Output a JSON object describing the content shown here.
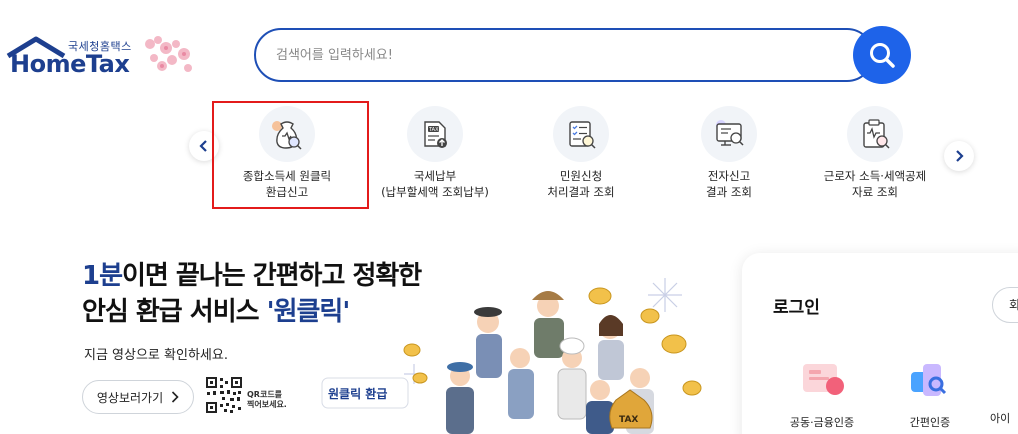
{
  "header": {
    "logo_sub": "국세청홈택스",
    "logo_main": "HomeTax",
    "search_placeholder": "검색어를 입력하세요!"
  },
  "quick_menu": [
    {
      "line1": "종합소득세 원클릭",
      "line2": "환급신고",
      "icon": "money-bag-search-icon"
    },
    {
      "line1": "국세납부",
      "line2": "(납부할세액 조회납부)",
      "icon": "tax-document-icon"
    },
    {
      "line1": "민원신청",
      "line2": "처리결과 조회",
      "icon": "checklist-search-icon"
    },
    {
      "line1": "전자신고",
      "line2": "결과 조회",
      "icon": "monitor-search-icon"
    },
    {
      "line1": "근로자 소득·세액공제",
      "line2": "자료 조회",
      "icon": "clipboard-search-icon"
    }
  ],
  "banner": {
    "title_accent": "1분",
    "title_line1_rest": "이면 끝나는 간편하고 정확한",
    "title_line2_plain": "안심 환급 서비스 ",
    "title_line2_accent": "'원클릭'",
    "subtitle": "지금 영상으로 확인하세요.",
    "video_button": "영상보러가기",
    "qr_line1": "QR코드를",
    "qr_line2": "찍어보세요.",
    "sign_text": "원클릭 환급",
    "bag_text": "TAX"
  },
  "login": {
    "title": "로그인",
    "button": "회원가입",
    "methods": [
      {
        "label": "공동·금융인증",
        "icon": "certificate-icon"
      },
      {
        "label": "간편인증",
        "icon": "simple-auth-icon"
      },
      {
        "label": "아이",
        "icon": "id-icon"
      }
    ]
  },
  "colors": {
    "brand": "#1d3f8f",
    "search_border": "#1e4fb6",
    "search_button": "#1e63e9",
    "highlight": "#e31b1b"
  }
}
